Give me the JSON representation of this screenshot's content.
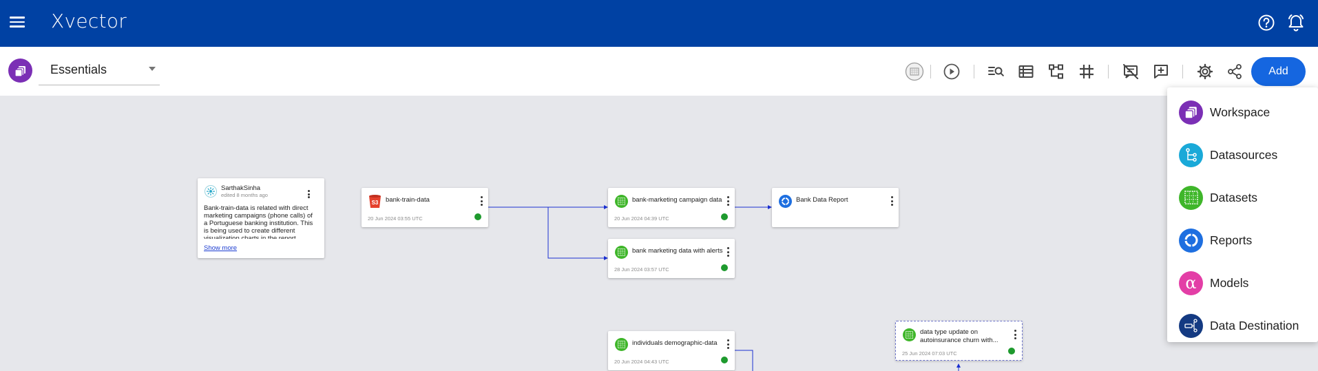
{
  "app": {
    "logo": "Xvector"
  },
  "toolbar": {
    "workspace": "Essentials",
    "add_label": "Add"
  },
  "colors": {
    "topbar": "#0041a3",
    "accent": "#1566e0",
    "status_ok": "#1e9a2e"
  },
  "note": {
    "user": "SarthakSinha",
    "edited": "edited 8 months ago",
    "text": "Bank-train-data is related with direct marketing campaigns (phone calls) of a Portuguese banking institution. This is being used to create different visualization charts in the report.",
    "more": "Show more"
  },
  "nodes": [
    {
      "title": "bank-train-data",
      "date": "20 Jun 2024 03:55 UTC",
      "kind": "datasource-s3"
    },
    {
      "title": "bank-marketing campaign data",
      "date": "20 Jun 2024 04:39 UTC",
      "kind": "dataset"
    },
    {
      "title": "Bank Data Report",
      "date": "",
      "kind": "report"
    },
    {
      "title": "bank marketing data with alerts",
      "date": "28 Jun 2024 03:57 UTC",
      "kind": "dataset"
    },
    {
      "title": "individuals demographic-data",
      "date": "20 Jun 2024 04:43 UTC",
      "kind": "dataset"
    },
    {
      "title": "data type update on autoinsurance churn with...",
      "date": "25 Jun 2024 07:03 UTC",
      "kind": "dataset"
    }
  ],
  "add_menu": {
    "items": [
      {
        "label": "Workspace",
        "icon": "workspace-icon",
        "color": "#7b2fb5"
      },
      {
        "label": "Datasources",
        "icon": "datasource-icon",
        "color": "#1aa9d8"
      },
      {
        "label": "Datasets",
        "icon": "dataset-icon",
        "color": "#3fb62a"
      },
      {
        "label": "Reports",
        "icon": "report-icon",
        "color": "#1e6fe0"
      },
      {
        "label": "Models",
        "icon": "model-icon",
        "color": "#e33ea6"
      },
      {
        "label": "Data Destination",
        "icon": "data-destination-icon",
        "color": "#143a82"
      }
    ]
  }
}
